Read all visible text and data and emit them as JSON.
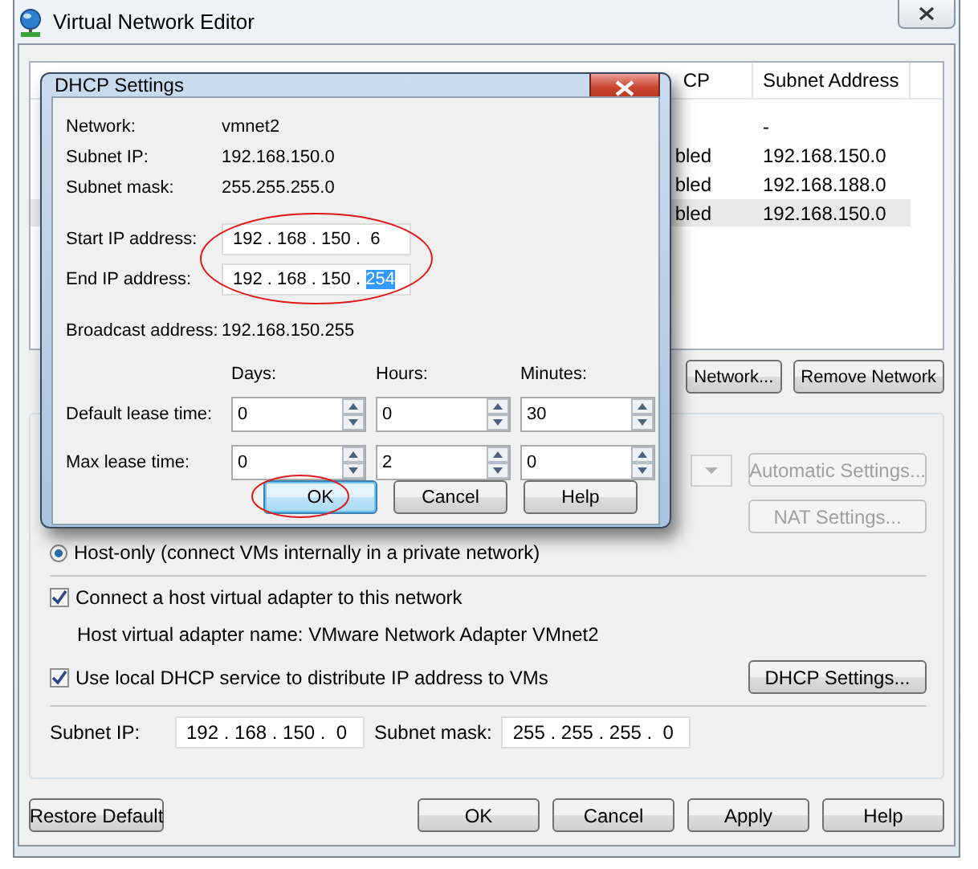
{
  "window": {
    "title": "Virtual Network Editor"
  },
  "network_table": {
    "columns": [
      "CP",
      "Subnet Address"
    ],
    "rows": [
      {
        "subnet": "-",
        "selected": false
      },
      {
        "dhcp": "bled",
        "subnet": "192.168.150.0",
        "selected": false
      },
      {
        "dhcp": "bled",
        "subnet": "192.168.188.0",
        "selected": false
      },
      {
        "dhcp": "bled",
        "subnet": "192.168.150.0",
        "selected": true
      }
    ]
  },
  "network_buttons": [
    {
      "label": "Network..."
    },
    {
      "label": "Remove Network"
    }
  ],
  "settings": {
    "bridge_dropdown": {
      "disabled": true
    },
    "side_buttons": [
      {
        "label": "Automatic Settings...",
        "disabled": true
      },
      {
        "label": "NAT Settings...",
        "disabled": true
      }
    ],
    "host_only": {
      "label": "Host-only (connect VMs internally in a private network)",
      "selected": true
    },
    "connect_adapter": {
      "label": "Connect a host virtual adapter to this network",
      "checked": true
    },
    "adapter_name": "Host virtual adapter name: VMware Network Adapter VMnet2",
    "use_dhcp": {
      "label": "Use local DHCP service to distribute IP address to VMs",
      "checked": true
    },
    "dhcp_button": {
      "label": "DHCP Settings..."
    },
    "subnet_ip": {
      "label": "Subnet IP:",
      "value": "192 . 168 . 150 .  0"
    },
    "subnet_mask": {
      "label": "Subnet mask:",
      "value": "255 . 255 . 255 .  0"
    }
  },
  "buttons": [
    {
      "label": "Restore Default",
      "default": false
    },
    {
      "label": "OK",
      "default": false
    },
    {
      "label": "Cancel",
      "default": false
    },
    {
      "label": "Apply",
      "default": false
    },
    {
      "label": "Help",
      "default": false
    }
  ],
  "dhcp_dialog": {
    "title": "DHCP Settings",
    "info": [
      {
        "label": "Network:",
        "value": "vmnet2"
      },
      {
        "label": "Subnet IP:",
        "value": "192.168.150.0"
      },
      {
        "label": "Subnet mask:",
        "value": "255.255.255.0"
      }
    ],
    "ip_range": {
      "circled": true,
      "fields": [
        {
          "label": "Start IP address:",
          "value": "192 . 168 . 150 .  6"
        },
        {
          "label": "End IP address:",
          "value": "192 . 168 . 150 . ",
          "selection": "254"
        }
      ]
    },
    "broadcast": {
      "label": "Broadcast address:",
      "value": "192.168.150.255"
    },
    "lease": {
      "columns": [
        "Days:",
        "Hours:",
        "Minutes:"
      ],
      "rows": [
        {
          "label": "Default lease time:",
          "values": [
            "0",
            "0",
            "30"
          ]
        },
        {
          "label": "Max lease time:",
          "values": [
            "0",
            "2",
            "0"
          ]
        }
      ]
    },
    "buttons": [
      {
        "label": "OK",
        "default": true,
        "circled": true
      },
      {
        "label": "Cancel",
        "default": false,
        "circled": false
      },
      {
        "label": "Help",
        "default": false,
        "circled": false
      }
    ]
  }
}
